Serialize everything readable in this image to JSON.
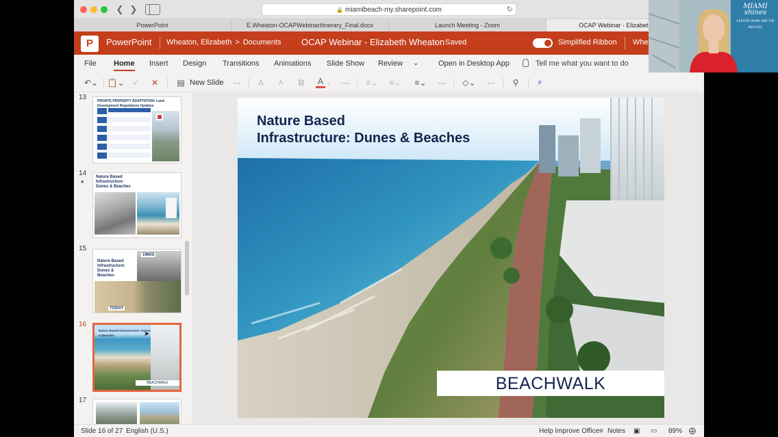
{
  "browser": {
    "url": "miamibeach-my.sharepoint.com",
    "tabs": [
      {
        "label": "PowerPoint",
        "active": false
      },
      {
        "label": "E.Wheaton-OCAPWebinarItinerary_Final.docx",
        "active": false
      },
      {
        "label": "Launch Meeting - Zoom",
        "active": false
      },
      {
        "label": "OCAP Webinar - Elizabeth Wheat",
        "active": true
      }
    ]
  },
  "header": {
    "app_name": "PowerPoint",
    "breadcrumb_owner": "Wheaton, Elizabeth",
    "breadcrumb_sep": ">",
    "breadcrumb_folder": "Documents",
    "doc_title": "OCAP Webinar - Elizabeth Wheaton",
    "dash": "-",
    "save_status": "Saved",
    "simplified_ribbon_label": "Simplified Ribbon",
    "simplified_ribbon_on": true,
    "user": "Whe",
    "accent_color": "#c43e1c"
  },
  "ribbon": {
    "tabs": [
      "File",
      "Home",
      "Insert",
      "Design",
      "Transitions",
      "Animations",
      "Slide Show",
      "Review"
    ],
    "active_tab": "Home",
    "open_desktop": "Open in Desktop App",
    "tell_me": "Tell me what you want to do"
  },
  "toolbar": {
    "new_slide": "New Slide",
    "more": "···",
    "grow_font": "A",
    "shrink_font": "A",
    "bold": "B",
    "font_color": "A"
  },
  "thumbnails": [
    {
      "num": "13",
      "title": "PRIVATE PROPERTY ADAPTATION: Land Development Regulations Updates",
      "selected": false
    },
    {
      "num": "14",
      "title": "Nature Based Infrastructure: Dunes & Beaches",
      "selected": false,
      "has_transition": true
    },
    {
      "num": "15",
      "title": "Nature Based Infrastructure: Dunes & Beaches",
      "label_top": "1960S",
      "label_bottom": "TODAY",
      "selected": false
    },
    {
      "num": "16",
      "title": "Nature Based Infrastructure: Dunes & Beaches",
      "label": "BEACHWALK",
      "selected": true
    },
    {
      "num": "17",
      "title": "",
      "selected": false
    }
  ],
  "slide": {
    "title_line1": "Nature Based",
    "title_line2": "Infrastructure: Dunes & Beaches",
    "caption": "BEACHWALK"
  },
  "status": {
    "slide_position": "Slide 16 of 27",
    "language": "English (U.S.)",
    "help": "Help Improve Office",
    "notes": "Notes",
    "zoom": "89%"
  },
  "video": {
    "logo_line1": "MIAMI",
    "logo_line2": "shines",
    "logo_tagline": "GREATER MIAMI AND THE BEACHES"
  }
}
